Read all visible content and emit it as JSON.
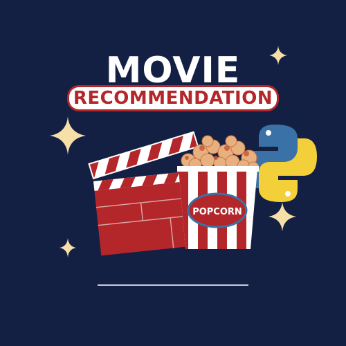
{
  "poster": {
    "title": "MOVIE",
    "subtitle": "RECOMMENDATION",
    "popcorn_label": "POPCORN",
    "colors": {
      "background": "#132044",
      "accent_red": "#b3262a",
      "sparkle": "#f7dfa8",
      "python_blue": "#3a72a8",
      "python_yellow": "#f3cf3a"
    },
    "icons": [
      "sparkle-icon",
      "clapperboard-icon",
      "popcorn-bucket-icon",
      "python-logo-icon"
    ]
  }
}
